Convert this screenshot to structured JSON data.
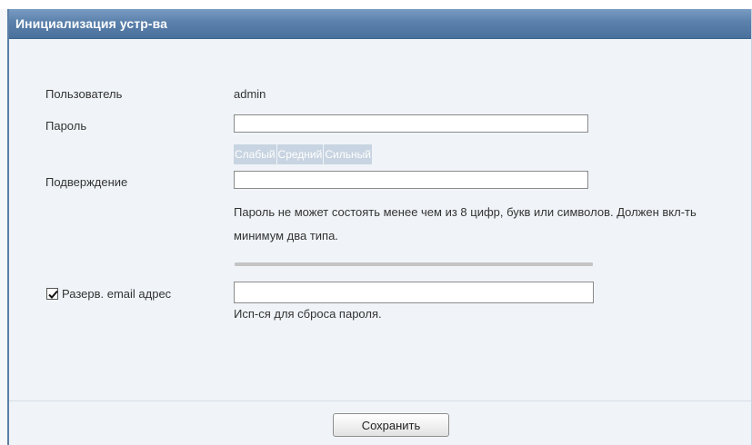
{
  "dialog": {
    "title": "Инициализация устр-ва"
  },
  "form": {
    "user_label": "Пользователь",
    "user_value": "admin",
    "password_label": "Пароль",
    "password_value": "",
    "strength": {
      "weak": "Слабый",
      "medium": "Средний",
      "strong": "Сильный"
    },
    "confirm_label": "Подверждение",
    "confirm_value": "",
    "password_hint": "Пароль не может состоять менее чем из 8 цифр, букв или символов. Должен вкл-ть минимум два типа.",
    "email_checkbox_checked": true,
    "email_label": "Разерв. email адрес",
    "email_value": "",
    "email_hint": "Исп-ся для сброса пароля."
  },
  "footer": {
    "save_label": "Сохранить"
  },
  "colors": {
    "titlebar": "#5a80ab",
    "strength_inactive": "#c8d4e1",
    "background": "#f0f4f8"
  }
}
